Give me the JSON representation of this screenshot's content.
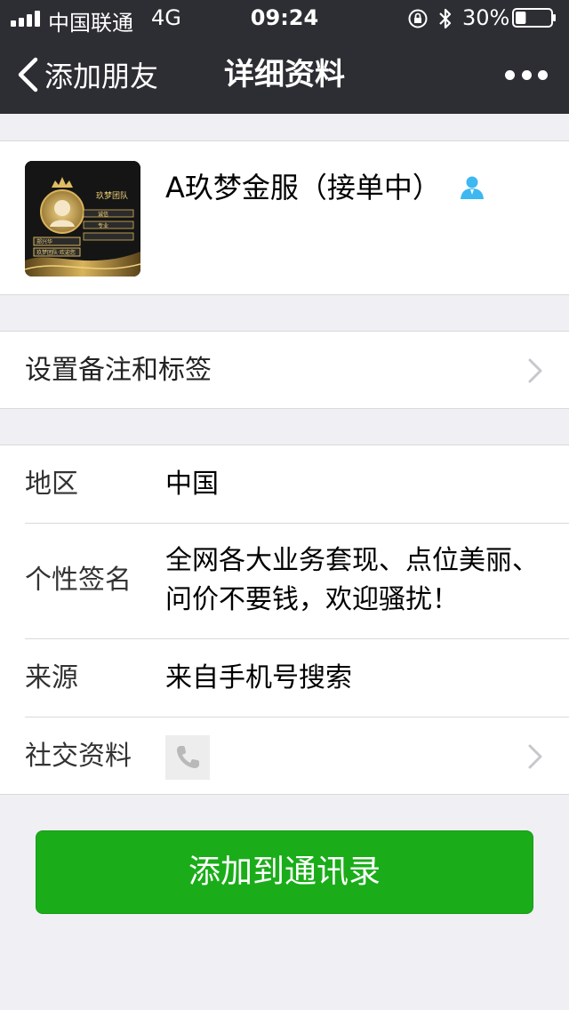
{
  "status_bar": {
    "carrier": "中国联通",
    "network": "4G",
    "time": "09:24",
    "battery_percent": "30%",
    "battery_level": 0.3,
    "signal_bars": 4
  },
  "nav": {
    "back_label": "添加朋友",
    "title": "详细资料"
  },
  "profile": {
    "name": "A玖梦金服（接单中）",
    "avatar_texts": [
      "玖梦团队",
      "诚信",
      "专业",
      "郑兴华",
      "玖梦团队·欢迎您"
    ]
  },
  "remark": {
    "label": "设置备注和标签"
  },
  "details": {
    "region_label": "地区",
    "region_value": "中国",
    "signature_label": "个性签名",
    "signature_line1": "全网各大业务套现、点位美丽、",
    "signature_line2": "问价不要钱，欢迎骚扰！",
    "source_label": "来源",
    "source_value": "来自手机号搜索",
    "social_label": "社交资料"
  },
  "actions": {
    "add_label": "添加到通讯录"
  },
  "colors": {
    "navbar_bg": "#2d2e33",
    "page_bg": "#efeff4",
    "primary_green": "#1aad19",
    "contact_icon": "#3db8f0"
  }
}
